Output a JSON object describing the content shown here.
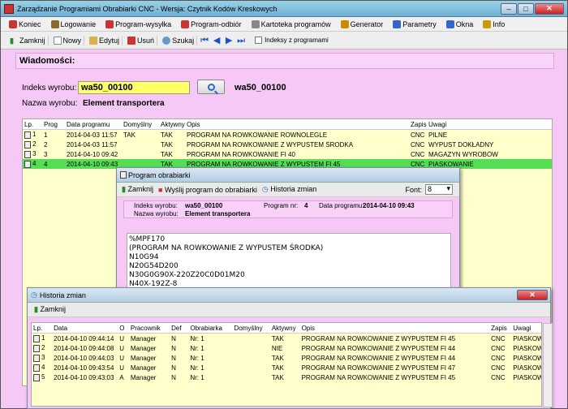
{
  "window": {
    "title": "Zarządzanie Programiami Obrabiarki CNC - Wersja: Czytnik Kodów Kreskowych"
  },
  "menu": [
    {
      "label": "Koniec",
      "icon": "exit-icon",
      "color": "#cc3333"
    },
    {
      "label": "Logowanie",
      "icon": "user-icon",
      "color": "#8a6a2a"
    },
    {
      "label": "Program-wysyłka",
      "icon": "send-icon",
      "color": "#cc3333"
    },
    {
      "label": "Program-odbiór",
      "icon": "receive-icon",
      "color": "#cc3333"
    },
    {
      "label": "Kartoteka programów",
      "icon": "folder-icon",
      "color": "#888888"
    },
    {
      "label": "Generator",
      "icon": "generator-icon",
      "color": "#cc8800"
    },
    {
      "label": "Parametry",
      "icon": "settings-icon",
      "color": "#3366cc"
    },
    {
      "label": "Okna",
      "icon": "windows-icon",
      "color": "#3366cc"
    },
    {
      "label": "Info",
      "icon": "info-icon",
      "color": "#cc9900"
    }
  ],
  "toolbar": {
    "close": "Zamknij",
    "new": "Nowy",
    "edit": "Edytuj",
    "delete": "Usuń",
    "search": "Szukaj",
    "indexes_checkbox": "Indeksy z programami"
  },
  "messages_label": "Wiadomości:",
  "product": {
    "index_label": "Indeks wyrobu:",
    "index_value": "wa50_00100",
    "index_display": "wa50_00100",
    "name_label": "Nazwa wyrobu:",
    "name_value": "Element transportera"
  },
  "grid": {
    "headers": [
      "Lp.",
      "Prog",
      "Data programu",
      "Domyślny",
      "Aktywny",
      "Opis",
      "Zapis",
      "Uwagi"
    ],
    "rows": [
      {
        "lp": "1",
        "prog": "1",
        "date": "2014-04-03 11:57",
        "def": "TAK",
        "active": "TAK",
        "desc": "PROGRAM NA ROWKOWANIE ROWNOLEGLE",
        "save": "CNC",
        "notes": "PILNE"
      },
      {
        "lp": "2",
        "prog": "2",
        "date": "2014-04-03 11:57",
        "def": "",
        "active": "TAK",
        "desc": "PROGRAM NA ROWKOWANIE Z WYPUSTEM ŚRODKA",
        "save": "CNC",
        "notes": "WYPUST DOKŁADNY"
      },
      {
        "lp": "3",
        "prog": "3",
        "date": "2014-04-10 09:42",
        "def": "",
        "active": "TAK",
        "desc": "PROGRAM NA ROWKOWANIE  FI 40",
        "save": "CNC",
        "notes": "MAGAZYN WYROBÓW"
      },
      {
        "lp": "4",
        "prog": "4",
        "date": "2014-04-10 09:43",
        "def": "",
        "active": "TAK",
        "desc": "PROGRAM NA ROWKOWANIE Z WYPUSTEM FI 45",
        "save": "CNC",
        "notes": "PIASKOWANIE"
      }
    ]
  },
  "program_window": {
    "title": "Program obrabiarki",
    "close": "Zamknij",
    "send": "Wyślij program do obrabiarki",
    "history": "Historia zmian",
    "font_label": "Font:",
    "font_value": "8",
    "index_label": "Indeks wyrobu:",
    "index_value": "wa50_00100",
    "prog_label": "Program nr:",
    "prog_value": "4",
    "date_label": "Data programu:",
    "date_value": "2014-04-10 09:43",
    "name_label": "Nazwa wyrobu:",
    "name_value": "Element transportera",
    "code_lines": [
      "%MPF170",
      "(PROGRAM NA ROWKOWANIE Z WYPUSTEM ŚRODKA)",
      "N10G94",
      "N20G54D200",
      "N30G0G90X-220Z20C0D01M20",
      "N40X-192Z-8"
    ]
  },
  "history_window": {
    "title": "Historia zmian",
    "close": "Zamknij",
    "headers": [
      "Lp.",
      "Data",
      "O",
      "Pracownik",
      "Def",
      "Obrabiarka",
      "Domyślny",
      "Aktywny",
      "Opis",
      "Zapis",
      "Uwagi"
    ],
    "rows": [
      {
        "lp": "1",
        "date": "2014-04-10 09:44:14",
        "o": "U",
        "worker": "Manager",
        "def": "N",
        "machine": "Nr: 1",
        "default": "",
        "active": "TAK",
        "desc": "PROGRAM NA ROWKOWANIE Z WYPUSTEM FI 45",
        "save": "CNC",
        "notes": "PIASKOW"
      },
      {
        "lp": "2",
        "date": "2014-04-10 09:44:08",
        "o": "U",
        "worker": "Manager",
        "def": "N",
        "machine": "Nr: 1",
        "default": "",
        "active": "NIE",
        "desc": "PROGRAM NA ROWKOWANIE Z WYPUSTEM FI 44",
        "save": "CNC",
        "notes": "PIASKOW"
      },
      {
        "lp": "3",
        "date": "2014-04-10 09:44:03",
        "o": "U",
        "worker": "Manager",
        "def": "N",
        "machine": "Nr: 1",
        "default": "",
        "active": "TAK",
        "desc": "PROGRAM NA ROWKOWANIE Z WYPUSTEM FI 44",
        "save": "CNC",
        "notes": "PIASKOW"
      },
      {
        "lp": "4",
        "date": "2014-04-10 09:43:54",
        "o": "U",
        "worker": "Manager",
        "def": "N",
        "machine": "Nr: 1",
        "default": "",
        "active": "TAK",
        "desc": "PROGRAM NA ROWKOWANIE Z WYPUSTEM FI 47",
        "save": "CNC",
        "notes": "PIASKOW"
      },
      {
        "lp": "5",
        "date": "2014-04-10 09:43:03",
        "o": "A",
        "worker": "Manager",
        "def": "N",
        "machine": "Nr: 1",
        "default": "",
        "active": "TAK",
        "desc": "PROGRAM NA ROWKOWANIE Z WYPUSTEM FI 45",
        "save": "CNC",
        "notes": "PIASKOW"
      }
    ]
  },
  "colors": {
    "accent": "#f5c8f5",
    "grid": "#ffffcc",
    "selected": "#55dd55",
    "highlight": "#ffff66"
  }
}
